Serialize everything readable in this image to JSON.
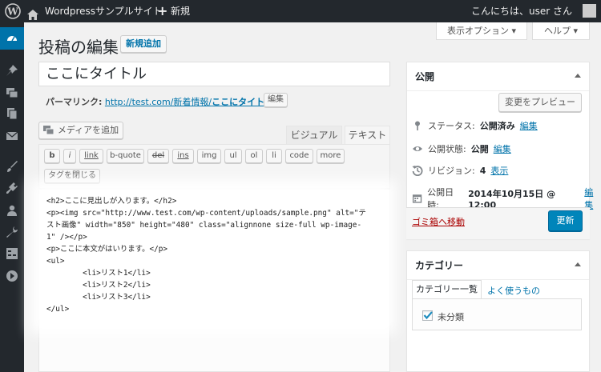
{
  "adminbar": {
    "site_name": "Wordpressサンプルサイト",
    "new_plus": "+",
    "new_label": "新規",
    "howdy": "こんにちは、user さん"
  },
  "page": {
    "title": "投稿の編集",
    "add_new": "新規追加",
    "screen_options": "表示オプション ▾",
    "help": "ヘルプ ▾"
  },
  "post": {
    "title_value": "ここにタイトル",
    "permalink_label": "パーマリンク:",
    "permalink_url": "http://test.com/新着情報/",
    "permalink_slug": "ここにタイトル",
    "permalink_trailing": "/",
    "permalink_edit": "編集"
  },
  "editor": {
    "add_media": "メディアを追加",
    "tab_visual": "ビジュアル",
    "tab_text": "テキスト",
    "quicktags": [
      "b",
      "i",
      "link",
      "b-quote",
      "del",
      "ins",
      "img",
      "ul",
      "ol",
      "li",
      "code",
      "more"
    ],
    "close_tags": "タグを閉じる",
    "content": "<h2>ここに見出しが入ります。</h2>\n<p><img src=\"http://www.test.com/wp-content/uploads/sample.png\" alt=\"テ\nスト画像\" width=\"850\" height=\"480\" class=\"alignnone size-full wp-image-\n1\" /></p>\n<p>ここに本文がはいります。</p>\n<ul>\n        <li>リスト1</li>\n        <li>リスト2</li>\n        <li>リスト3</li>\n</ul>"
  },
  "publish_box": {
    "title": "公開",
    "preview": "変更をプレビュー",
    "status_label": "ステータス:",
    "status_value": "公開済み",
    "status_edit": "編集",
    "visibility_label": "公開状態:",
    "visibility_value": "公開",
    "visibility_edit": "編集",
    "revisions_label": "リビジョン:",
    "revisions_value": "4",
    "revisions_link": "表示",
    "date_label": "公開日時:",
    "date_value": "2014年10月15日 @ 12:00",
    "date_edit": "編集",
    "trash": "ゴミ箱へ移動",
    "update": "更新"
  },
  "category_box": {
    "title": "カテゴリー",
    "tab_all": "カテゴリー一覧",
    "tab_popular": "よく使うもの",
    "items": [
      {
        "label": "未分類",
        "checked": true
      }
    ]
  },
  "colors": {
    "adminbar_bg": "#23282d",
    "accent": "#0073aa",
    "primary_button": "#0085ba",
    "trash": "#a00000"
  }
}
